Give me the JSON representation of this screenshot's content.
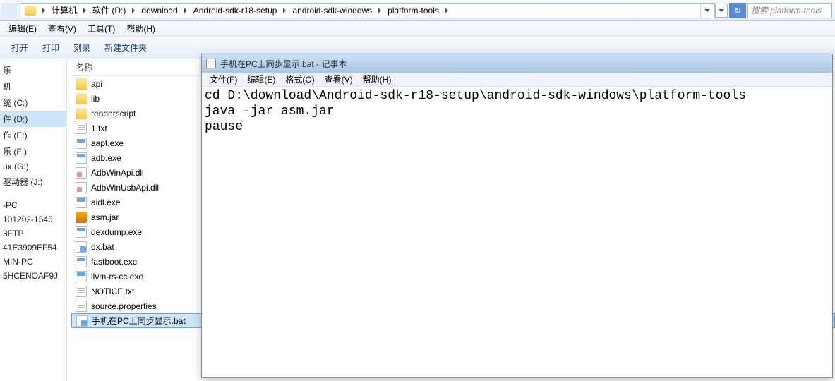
{
  "breadcrumbs": [
    "计算机",
    "软件 (D:)",
    "download",
    "Android-sdk-r18-setup",
    "android-sdk-windows",
    "platform-tools"
  ],
  "search_placeholder": "搜索 platform-tools",
  "explorer_menu": {
    "edit": "编辑(E)",
    "view": "查看(V)",
    "tools": "工具(T)",
    "help": "帮助(H)"
  },
  "toolbar": {
    "open": "打开",
    "print": "打印",
    "burn": "刻录",
    "newfolder": "新建文件夹"
  },
  "nav": {
    "items_top": [
      "乐",
      "机",
      "统 (C:)",
      "件 (D:)",
      "作 (E:)",
      "乐 (F:)",
      "ux (G:)",
      "驱动器 (J:)"
    ],
    "items_bot": [
      "-PC",
      "101202-1545",
      "3FTP",
      "41E3909EF54",
      "MIN-PC",
      "5HCENOAF9J"
    ],
    "selected": "件 (D:)"
  },
  "list": {
    "header": "名称",
    "files": [
      {
        "name": "api",
        "type": "folder"
      },
      {
        "name": "lib",
        "type": "folder"
      },
      {
        "name": "renderscript",
        "type": "folder"
      },
      {
        "name": "1.txt",
        "type": "txt"
      },
      {
        "name": "aapt.exe",
        "type": "exe"
      },
      {
        "name": "adb.exe",
        "type": "exe"
      },
      {
        "name": "AdbWinApi.dll",
        "type": "dll"
      },
      {
        "name": "AdbWinUsbApi.dll",
        "type": "dll"
      },
      {
        "name": "aidl.exe",
        "type": "exe"
      },
      {
        "name": "asm.jar",
        "type": "jar"
      },
      {
        "name": "dexdump.exe",
        "type": "exe"
      },
      {
        "name": "dx.bat",
        "type": "bat"
      },
      {
        "name": "fastboot.exe",
        "type": "exe"
      },
      {
        "name": "llvm-rs-cc.exe",
        "type": "exe"
      },
      {
        "name": "NOTICE.txt",
        "type": "txt"
      },
      {
        "name": "source.properties",
        "type": "txt"
      },
      {
        "name": "手机在PC上同步显示.bat",
        "type": "bat",
        "selected": true
      }
    ]
  },
  "notepad": {
    "title": "手机在PC上同步显示.bat - 记事本",
    "menu": {
      "file": "文件(F)",
      "edit": "编辑(E)",
      "format": "格式(O)",
      "view": "查看(V)",
      "help": "帮助(H)"
    },
    "content": "cd D:\\download\\Android-sdk-r18-setup\\android-sdk-windows\\platform-tools\njava -jar asm.jar\npause"
  }
}
